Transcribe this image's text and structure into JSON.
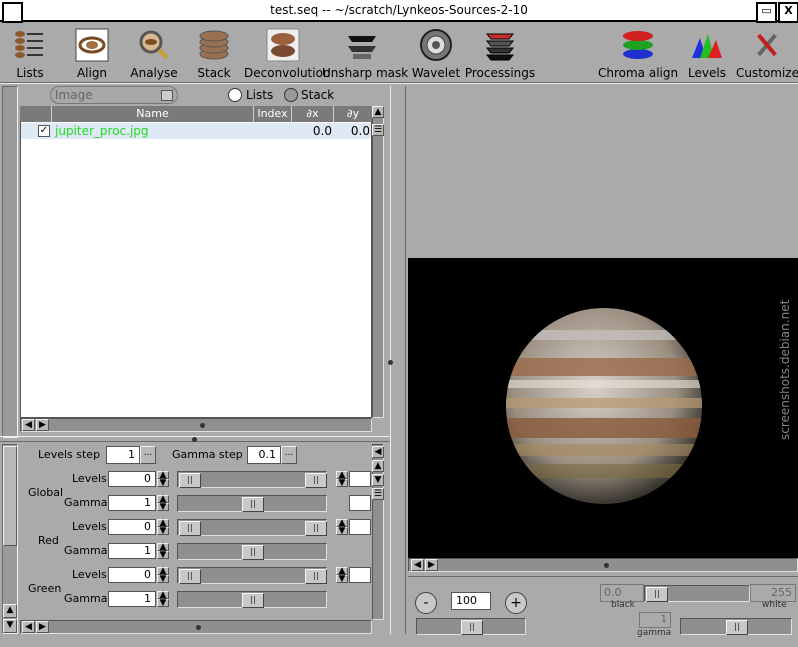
{
  "window": {
    "title": "test.seq  --  ~/scratch/Lynkeos-Sources-2-10",
    "close_glyph": "X",
    "max_glyph": "▭"
  },
  "toolbar": [
    {
      "name": "lists",
      "label": "Lists"
    },
    {
      "name": "align",
      "label": "Align"
    },
    {
      "name": "analyse",
      "label": "Analyse"
    },
    {
      "name": "stack",
      "label": "Stack"
    },
    {
      "name": "deconvolution",
      "label": "Deconvolution"
    },
    {
      "name": "unsharp-mask",
      "label": "Unsharp mask"
    },
    {
      "name": "wavelet",
      "label": "Wavelet"
    },
    {
      "name": "processings",
      "label": "Processings"
    },
    {
      "name": "chroma-align",
      "label": "Chroma align"
    },
    {
      "name": "levels",
      "label": "Levels"
    },
    {
      "name": "customize",
      "label": "Customize"
    }
  ],
  "list_panel": {
    "filter_placeholder": "Image",
    "radio_lists": "Lists",
    "radio_stack": "Stack",
    "columns": [
      "Name",
      "Index",
      "∂x",
      "∂y"
    ],
    "rows": [
      {
        "name": "jupiter_proc.jpg",
        "index": "",
        "dx": "0.0",
        "dy": "0.0",
        "checked": true
      }
    ]
  },
  "levels_panel": {
    "levels_step_label": "Levels step",
    "levels_step_value": "1",
    "gamma_step_label": "Gamma step",
    "gamma_step_value": "0.1",
    "ellipsis": "...",
    "groups": [
      {
        "name": "Global",
        "levels_label": "Levels",
        "levels_value": "0",
        "gamma_label": "Gamma",
        "gamma_value": "1"
      },
      {
        "name": "Red",
        "levels_label": "Levels",
        "levels_value": "0",
        "gamma_label": "Gamma",
        "gamma_value": "1"
      },
      {
        "name": "Green",
        "levels_label": "Levels",
        "levels_value": "0",
        "gamma_label": "Gamma",
        "gamma_value": "1"
      }
    ]
  },
  "image_view": {
    "watermark": "screenshots.debian.net",
    "zoom_value": "100",
    "zoom_minus": "-",
    "zoom_plus": "+",
    "black_value": "0.0",
    "black_label": "black",
    "white_value": "255",
    "white_label": "white",
    "gamma_value": "1",
    "gamma_label": "gamma"
  },
  "colors": {
    "list_item_text": "#22dd22",
    "window_bg": "#aaaaaa",
    "selected_row": "#dfe8f5"
  }
}
